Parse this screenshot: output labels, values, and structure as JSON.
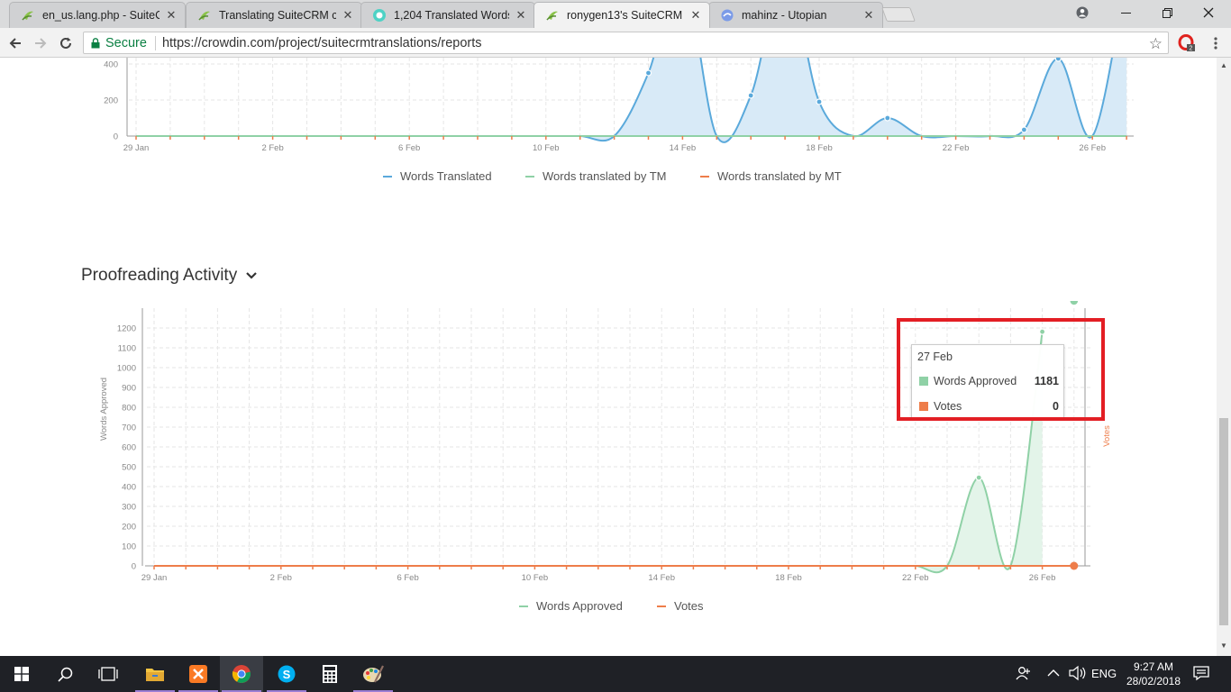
{
  "browser": {
    "tabs": [
      {
        "title": "en_us.lang.php - SuiteCR",
        "active": false
      },
      {
        "title": "Translating SuiteCRM co",
        "active": false
      },
      {
        "title": "1,204 Translated Words o",
        "active": false
      },
      {
        "title": "ronygen13's SuiteCRM co",
        "active": true
      },
      {
        "title": "mahinz - Utopian",
        "active": false
      }
    ],
    "secure_label": "Secure",
    "url": "https://crowdin.com/project/suitecrmtranslations/reports",
    "extension_badge": "2"
  },
  "translation_chart": {
    "chart_data": {
      "type": "area",
      "x": [
        "29 Jan",
        "30 Jan",
        "31 Jan",
        "1 Feb",
        "2 Feb",
        "3 Feb",
        "4 Feb",
        "5 Feb",
        "6 Feb",
        "7 Feb",
        "8 Feb",
        "9 Feb",
        "10 Feb",
        "11 Feb",
        "12 Feb",
        "13 Feb",
        "14 Feb",
        "15 Feb",
        "16 Feb",
        "17 Feb",
        "18 Feb",
        "19 Feb",
        "20 Feb",
        "21 Feb",
        "22 Feb",
        "23 Feb",
        "24 Feb",
        "25 Feb",
        "26 Feb",
        "27 Feb"
      ],
      "xticks": [
        "29 Jan",
        "2 Feb",
        "6 Feb",
        "10 Feb",
        "14 Feb",
        "18 Feb",
        "22 Feb",
        "26 Feb"
      ],
      "yticks": [
        "0",
        "200",
        "400"
      ],
      "series": [
        {
          "name": "Words Translated",
          "color": "#5aa9db",
          "values": [
            0,
            0,
            0,
            0,
            0,
            0,
            0,
            0,
            0,
            0,
            0,
            0,
            0,
            0,
            0,
            350,
            900,
            0,
            225,
            900,
            190,
            0,
            100,
            0,
            0,
            0,
            35,
            430,
            0,
            900
          ]
        },
        {
          "name": "Words translated by TM",
          "color": "#8fd1a6",
          "values": [
            0,
            0,
            0,
            0,
            0,
            0,
            0,
            0,
            0,
            0,
            0,
            0,
            0,
            0,
            0,
            0,
            0,
            0,
            0,
            0,
            0,
            0,
            0,
            0,
            0,
            0,
            0,
            0,
            0,
            0
          ]
        },
        {
          "name": "Words translated by MT",
          "color": "#ee7d4a",
          "values": [
            0,
            0,
            0,
            0,
            0,
            0,
            0,
            0,
            0,
            0,
            0,
            0,
            0,
            0,
            0,
            0,
            0,
            0,
            0,
            0,
            0,
            0,
            0,
            0,
            0,
            0,
            0,
            0,
            0,
            0
          ]
        }
      ]
    }
  },
  "proofreading": {
    "title": "Proofreading Activity",
    "chart_data": {
      "type": "area",
      "x": [
        "29 Jan",
        "30 Jan",
        "31 Jan",
        "1 Feb",
        "2 Feb",
        "3 Feb",
        "4 Feb",
        "5 Feb",
        "6 Feb",
        "7 Feb",
        "8 Feb",
        "9 Feb",
        "10 Feb",
        "11 Feb",
        "12 Feb",
        "13 Feb",
        "14 Feb",
        "15 Feb",
        "16 Feb",
        "17 Feb",
        "18 Feb",
        "19 Feb",
        "20 Feb",
        "21 Feb",
        "22 Feb",
        "23 Feb",
        "24 Feb",
        "25 Feb",
        "26 Feb",
        "27 Feb"
      ],
      "xticks": [
        "29 Jan",
        "2 Feb",
        "6 Feb",
        "10 Feb",
        "14 Feb",
        "18 Feb",
        "22 Feb",
        "26 Feb"
      ],
      "yticks": [
        "0",
        "100",
        "200",
        "300",
        "400",
        "500",
        "600",
        "700",
        "800",
        "900",
        "1000",
        "1100",
        "1200"
      ],
      "ylabel": "Words Approved",
      "y2label": "Votes",
      "ylim": [
        0,
        1280
      ],
      "series": [
        {
          "name": "Words Approved",
          "color": "#8fd1a6",
          "values": [
            0,
            0,
            0,
            0,
            0,
            0,
            0,
            0,
            0,
            0,
            0,
            0,
            0,
            0,
            0,
            0,
            0,
            0,
            0,
            0,
            0,
            0,
            0,
            0,
            0,
            0,
            445,
            0,
            1181
          ]
        },
        {
          "name": "Votes",
          "color": "#ee7d4a",
          "values": [
            0,
            0,
            0,
            0,
            0,
            0,
            0,
            0,
            0,
            0,
            0,
            0,
            0,
            0,
            0,
            0,
            0,
            0,
            0,
            0,
            0,
            0,
            0,
            0,
            0,
            0,
            0,
            0,
            0,
            0
          ]
        }
      ]
    },
    "tooltip": {
      "date": "27 Feb",
      "rows": [
        {
          "label": "Words Approved",
          "value": "1181",
          "color": "#8fd1a6"
        },
        {
          "label": "Votes",
          "value": "0",
          "color": "#ee7d4a"
        }
      ]
    }
  },
  "taskbar": {
    "language": "ENG",
    "time": "9:27 AM",
    "date": "28/02/2018"
  }
}
